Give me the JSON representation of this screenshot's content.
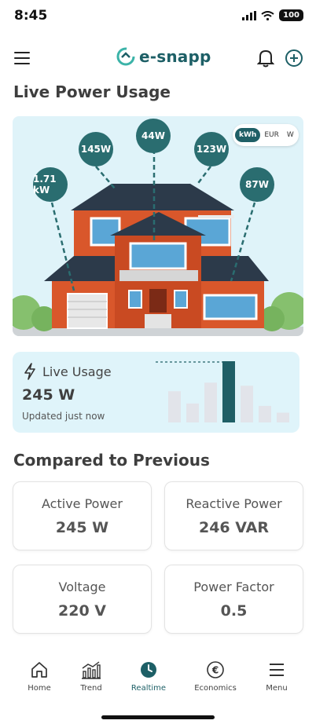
{
  "status_bar": {
    "time": "8:45",
    "battery": "100"
  },
  "header": {
    "logo_text": "e-snapp"
  },
  "live_power": {
    "title": "Live Power Usage",
    "unit_toggle": {
      "options": [
        "kWh",
        "EUR",
        "W"
      ],
      "selected": "kWh"
    },
    "bubbles": [
      "1.71 kW",
      "145W",
      "44W",
      "123W",
      "87W"
    ]
  },
  "live_usage": {
    "title": "Live Usage",
    "value": "245 W",
    "updated": "Updated just now",
    "bar_levels": [
      0.51,
      0.31,
      0.65,
      1.0,
      0.6,
      0.27,
      0.16
    ],
    "highlight_index": 3
  },
  "compared": {
    "title": "Compared to Previous",
    "cards": [
      {
        "label": "Active Power",
        "value": "245 W"
      },
      {
        "label": "Reactive Power",
        "value": "246 VAR"
      },
      {
        "label": "Voltage",
        "value": "220 V"
      },
      {
        "label": "Power Factor",
        "value": "0.5"
      }
    ]
  },
  "nav": {
    "items": [
      {
        "label": "Home",
        "icon": "home-icon"
      },
      {
        "label": "Trend",
        "icon": "trend-icon"
      },
      {
        "label": "Realtime",
        "icon": "clock-icon"
      },
      {
        "label": "Economics",
        "icon": "euro-icon"
      },
      {
        "label": "Menu",
        "icon": "menu-icon"
      }
    ],
    "active": "Realtime"
  },
  "colors": {
    "accent": "#1f5f66",
    "panel_bg": "#dff3f9",
    "bar_muted": "#e2e4ea"
  }
}
